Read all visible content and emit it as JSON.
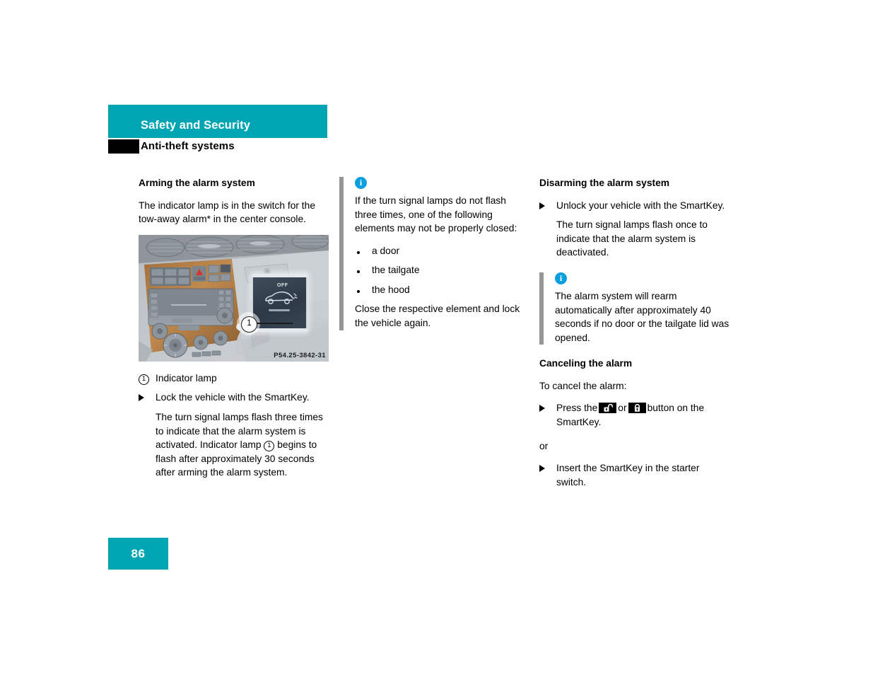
{
  "header": {
    "chapter": "Safety and Security",
    "section": "Anti-theft systems"
  },
  "colors": {
    "accent_teal": "#00a5b4",
    "info_blue": "#0c9fe0",
    "rule_gray": "#969696",
    "swatch_black": "#000000"
  },
  "left_column": {
    "heading": "Arming the alarm system",
    "intro": "The indicator lamp is in the switch for the tow-away alarm* in the center console.",
    "figure": {
      "code": "P54.25-3842-31",
      "switch_label": "OFF",
      "callout_number": "1",
      "alt": "Center console showing the tow-away alarm switch with indicator lamp"
    },
    "legend": {
      "number": "1",
      "label": "Indicator lamp"
    },
    "step": "Lock the vehicle with the SmartKey.",
    "step_detail_a": "The turn signal lamps flash three times to indicate that the alarm system is activated. Indicator lamp",
    "step_detail_number": "1",
    "step_detail_b": "begins to flash after approximately 30 seconds after arming the alarm system."
  },
  "middle_column": {
    "info": {
      "icon": "info-icon",
      "text": "If the turn signal lamps do not flash three times, one of the following elements may not be properly closed:",
      "bullets": [
        "a door",
        "the tailgate",
        "the hood"
      ],
      "closing": "Close the respective element and lock the vehicle again."
    }
  },
  "right_column": {
    "heading_disarm": "Disarming the alarm system",
    "step_disarm": "Unlock your vehicle with the SmartKey.",
    "step_disarm_detail": "The turn signal lamps flash once to indicate that the alarm system is deactivated.",
    "info": {
      "icon": "info-icon",
      "text": "The alarm system will rearm automatically after approximately 40 seconds if no door or the tailgate lid was opened."
    },
    "heading_cancel": "Canceling the alarm",
    "cancel_intro": "To cancel the alarm:",
    "cancel_step_a": "Press the",
    "cancel_icon_unlock": "unlock-button-icon",
    "cancel_step_or": "or",
    "cancel_icon_lock": "lock-button-icon",
    "cancel_step_b": "button on the SmartKey.",
    "or_separator": "or",
    "cancel_step2": "Insert the SmartKey in the starter switch."
  },
  "footer": {
    "page_number": "86"
  }
}
